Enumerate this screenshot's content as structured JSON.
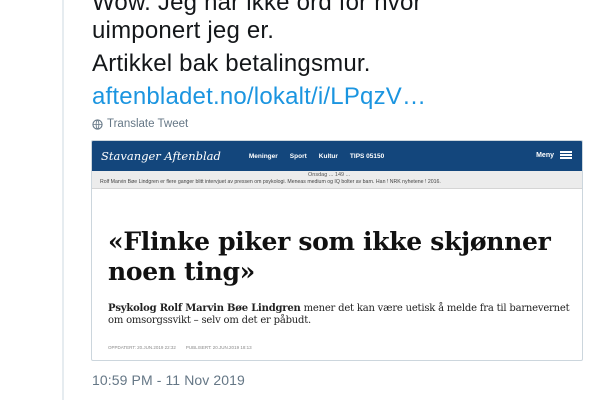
{
  "tweet": {
    "lines": [
      "Wow. Jeg har ikke ord for hvor",
      "uimponert jeg er.",
      "Artikkel bak betalingsmur.",
      "aftenbladet.no/lokalt/i/LPqzV…"
    ],
    "translate_label": "Translate Tweet",
    "timestamp": "10:59 PM - 11 Nov 2019",
    "colors": {
      "text": "#14171a",
      "link": "#1b95e0",
      "muted": "#657786"
    }
  },
  "card": {
    "brand": "Stavanger Aftenblad",
    "nav": [
      "Meninger",
      "Sport",
      "Kultur",
      "TIPS 05150"
    ],
    "menu_label": "Meny",
    "caption_top": "Onsdag ... 149 ...",
    "caption": "Rolf Marvin Bøe Lindgren er flere ganger blitt intervjuet av pressen om psykologi. Meneas medium og IQ bolter av barn. Han ! NRK nyhetene ! 2016.",
    "headline": "«Flinke piker som ikke skjønner noen ting»",
    "lead_bold": "Psykolog Rolf Marvin Bøe Lindgren",
    "lead_rest": "mener det kan være uetisk å melde fra til barnevernet om omsorgssvikt – selv om det er påbudt.",
    "published": "OPPDATERT: 20.JUN.2019 22:32",
    "updated": "PUBLISERT: 20.JUN.2019 18:13",
    "colors": {
      "navbar": "#13467c"
    }
  }
}
